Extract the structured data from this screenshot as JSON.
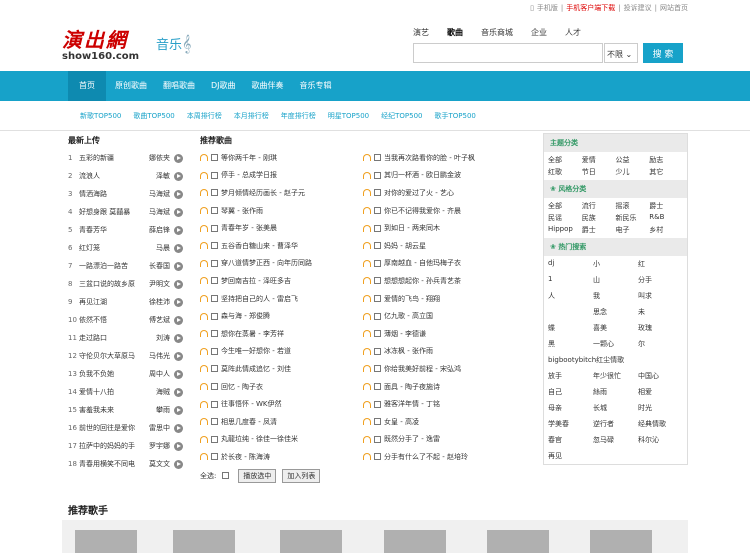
{
  "top": {
    "items": [
      "手机版",
      "手机客户端下载",
      "投诉建议",
      "网站首页"
    ]
  },
  "logo": {
    "cn": "演出網",
    "en": "show160.com",
    "music": "音乐"
  },
  "search": {
    "tabs": [
      "演艺",
      "歌曲",
      "音乐商城",
      "企业",
      "人才"
    ],
    "active": 1,
    "select": "不限",
    "button": "搜 索"
  },
  "nav": {
    "items": [
      "首页",
      "原创歌曲",
      "翻唱歌曲",
      "DJ歌曲",
      "歌曲伴奏",
      "音乐专辑"
    ]
  },
  "subnav": {
    "items": [
      "新歌TOP500",
      "歌曲TOP500",
      "本周排行榜",
      "本月排行榜",
      "年度排行榜",
      "明星TOP500",
      "经纪TOP500",
      "歌手TOP500"
    ]
  },
  "latest": {
    "title": "最新上传",
    "rows": [
      [
        "1",
        "五彩的新疆",
        "娜依夹"
      ],
      [
        "2",
        "流浪人",
        "泽敏"
      ],
      [
        "3",
        "情洒海路",
        "马海斌"
      ],
      [
        "4",
        "好想身跟 莫囍暴",
        "马海斌"
      ],
      [
        "5",
        "青春芳华",
        "薛启锋"
      ],
      [
        "6",
        "红灯笼",
        "马晨"
      ],
      [
        "7",
        "一路漂泊一路苦",
        "长春国"
      ],
      [
        "8",
        "三盆口说的故乡原",
        "尹明文"
      ],
      [
        "9",
        "再见江湖",
        "徐桂沛"
      ],
      [
        "10",
        "依然不悟",
        "傅艺斌"
      ],
      [
        "11",
        "走过路口",
        "刘涛"
      ],
      [
        "12",
        "守伦贝尔大草原马",
        "马伟光"
      ],
      [
        "13",
        "负我不负她",
        "周中人"
      ],
      [
        "14",
        "爱情十八拍",
        "海贼"
      ],
      [
        "15",
        "害羞我未来",
        "攀雨"
      ],
      [
        "16",
        "前世的回往是爱你",
        "雷思中"
      ],
      [
        "17",
        "拉萨中的妈妈的手",
        "罗宇娜"
      ],
      [
        "18",
        "青春用横笑不同电",
        "莫文文"
      ]
    ]
  },
  "recsongs": {
    "title": "推荐歌曲",
    "items": [
      "等你两千年 - 刚琪",
      "当我再次路看你的脸 - 叶子枫",
      "停手 - 总成学日报",
      "其归一杯酒 - 欧日鹏金波",
      "梦月倾情经历画长 - 赵子元",
      "对你的爱过了火 - 艺心",
      "琴翼 - 张作雨",
      "你已不记得我爱你 - 齐晨",
      "青春年岁 - 张美晨",
      "到如日 - 两来同木",
      "五谷香白糖山来 - 曹泽华",
      "妈妈 - 胡云星",
      "穿八道情梦正西 - 向年历同路",
      "厚南越血 - 自他玛梅子衣",
      "梦回南吉拉 - 泽旺多吉",
      "想想想起你 - 孙兵青艺茶",
      "坚持把自己的人 - 雷启飞",
      "爱情的飞鸟 - 翔翔",
      "森与海 - 郑俊腾",
      "亿九歌 - 高立国",
      "想你在蒸暑 - 李芳祥",
      "薄烟 - 李德谦",
      "今生唯一好想你 - 若道",
      "冰冻枫 - 张作雨",
      "莫阵此情成追忆 - 刘佳",
      "你给我美好前程 - 宋弘鸿",
      "回忆 - 陶子衣",
      "面具 - 陶子夜施诗",
      "往事悟怀 - WK伊然",
      "雅客洋年情 - 丁铭",
      "相思几度春 - 凤清",
      "女皇 - 高凌",
      "丸龍垃纯 - 徐佳一徐佳米",
      "既然分手了 - 逸雷",
      "於长夜 - 陈海涛",
      "分手有什么了不起 - 赵培玲"
    ],
    "select_all": "全选:",
    "play": "播放选中",
    "add": "加入列表"
  },
  "right": {
    "themes": {
      "title": "主题分类",
      "items": [
        "全部",
        "爱情",
        "公益",
        "励志",
        "红歌",
        "节日",
        "少儿",
        "其它"
      ]
    },
    "styles": {
      "title": "风格分类",
      "items": [
        "全部",
        "流行",
        "摇滚",
        "爵士",
        "民谣",
        "民族",
        "新民乐",
        "R&B",
        "Hippop",
        "爵士",
        "电子",
        "乡村"
      ]
    },
    "hot": {
      "title": "热门搜索",
      "items": [
        "dj",
        "小",
        "红",
        "1",
        "山",
        "分手",
        "人",
        "我",
        "叫求",
        "",
        "思念",
        "未",
        "蝶",
        "喜美",
        "玫瑰",
        "黑",
        "一颗心",
        "尔",
        "bigbootybitch红尘情歌",
        "",
        "放手",
        "年少很忙",
        "中国心",
        "自己",
        "絲雨",
        "相爱",
        "母亲",
        "长城",
        "时光",
        "学美春",
        "逆行者",
        "经典情歌",
        "春官",
        "忽马碌",
        "科尔沁",
        "再见"
      ]
    }
  },
  "singers": {
    "title": "推荐歌手"
  }
}
